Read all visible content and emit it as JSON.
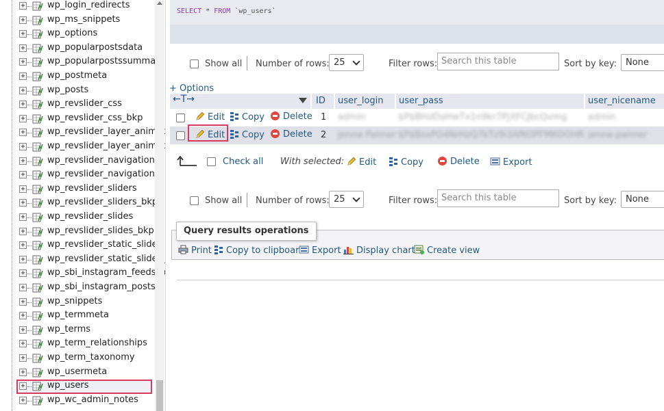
{
  "sidebar": {
    "tables": [
      "wp_login_redirects",
      "wp_ms_snippets",
      "wp_options",
      "wp_popularpostsdata",
      "wp_popularpostssummary",
      "wp_postmeta",
      "wp_posts",
      "wp_revslider_css",
      "wp_revslider_css_bkp",
      "wp_revslider_layer_animat",
      "wp_revslider_layer_animat",
      "wp_revslider_navigations",
      "wp_revslider_navigations_",
      "wp_revslider_sliders",
      "wp_revslider_sliders_bkp",
      "wp_revslider_slides",
      "wp_revslider_slides_bkp",
      "wp_revslider_static_slides",
      "wp_revslider_static_slides_",
      "wp_sbi_instagram_feeds_p",
      "wp_sbi_instagram_posts",
      "wp_snippets",
      "wp_termmeta",
      "wp_terms",
      "wp_term_relationships",
      "wp_term_taxonomy",
      "wp_usermeta",
      "wp_users",
      "wp_wc_admin_notes"
    ],
    "selected_table": "wp_users",
    "expander_symbol": "+"
  },
  "sql": {
    "keyword_select": "SELECT",
    "star": "*",
    "keyword_from": "FROM",
    "table": "`wp_users`"
  },
  "nav": {
    "show_all": "Show all",
    "number_of_rows_label": "Number of rows:",
    "number_of_rows_value": "25",
    "filter_rows_label": "Filter rows:",
    "filter_placeholder": "Search this table",
    "sort_by_key_label": "Sort by key:",
    "sort_by_key_value": "None"
  },
  "options_link": "+ Options",
  "table": {
    "arrows": "←T→",
    "columns": [
      "ID",
      "user_login",
      "user_pass",
      "user_nicename"
    ],
    "rows": [
      {
        "id": "1",
        "user_login": "admin",
        "user_pass": "$P$BHdDaHwTx1n9kr7PjXFCJbcQvmg",
        "user_nicename": "admin"
      },
      {
        "id": "2",
        "user_login": "Jenna Palmer",
        "user_pass": "$P$BsxPO4NrHzQ7kTz9i3AfKOPFMKOOHR",
        "user_nicename": "jenna-palmer"
      }
    ],
    "actions": {
      "edit": "Edit",
      "copy": "Copy",
      "delete": "Delete"
    }
  },
  "with_selected": {
    "check_all": "Check all",
    "label": "With selected:",
    "edit": "Edit",
    "copy": "Copy",
    "delete": "Delete",
    "export": "Export"
  },
  "query_ops": {
    "title": "Query results operations",
    "print": "Print",
    "copy_clipboard": "Copy to clipboard",
    "export": "Export",
    "display_chart": "Display chart",
    "create_view": "Create view"
  },
  "colors": {
    "link": "#235a81",
    "highlight": "#d63a5e",
    "row_alt": "#dfe0e8",
    "header_bg": "#e5e6ee"
  }
}
